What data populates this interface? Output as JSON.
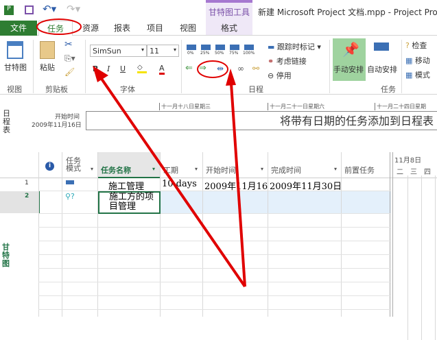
{
  "titlebar": {
    "title": "新建 Microsoft Project 文档.mpp - Project Profess",
    "context_group": "甘特图工具"
  },
  "tabs": [
    "文件",
    "任务",
    "资源",
    "报表",
    "项目",
    "视图",
    "格式"
  ],
  "ribbon": {
    "view": {
      "gantt": "甘特图",
      "group": "视图"
    },
    "clipboard": {
      "paste": "粘贴",
      "group": "剪贴板"
    },
    "font": {
      "name": "SimSun",
      "size": "11",
      "bold": "B",
      "italic": "I",
      "underline": "U",
      "font_color": "A",
      "group": "字体"
    },
    "schedule": {
      "percents": [
        "0%",
        "25%",
        "50%",
        "75%",
        "100%"
      ],
      "track": "跟踪时标记",
      "respect_links": "考虑链接",
      "inactivate": "停用",
      "group": "日程"
    },
    "tasks": {
      "manual": "手动安排",
      "auto": "自动安排",
      "inspect": "检查",
      "move": "移动",
      "mode": "模式",
      "group": "任务"
    }
  },
  "timeline": {
    "side_label": "日程表",
    "start_label": "开始时间",
    "start_date": "2009年11月16日",
    "dates": [
      "十一月十八日星期三",
      "十一月二十一日星期六",
      "十一月二十四日星期"
    ],
    "placeholder": "将带有日期的任务添加到日程表"
  },
  "grid": {
    "side_label": "甘特图",
    "columns": [
      "任务模式",
      "任务名称",
      "工期",
      "开始时间",
      "完成时间",
      "前置任务"
    ],
    "rows": [
      {
        "id": "1",
        "name": "施工管理",
        "duration": "10 days",
        "start": "2009年11月16日",
        "finish": "2009年11月30日"
      },
      {
        "id": "2",
        "name": "施工方的项目管理",
        "duration": "",
        "start": "",
        "finish": ""
      }
    ]
  },
  "chart": {
    "date": "11月8日",
    "days": [
      "二",
      "三",
      "四"
    ]
  },
  "colors": {
    "file_tab": "#2e7d32",
    "accent": "#217346",
    "annotation": "#e00000",
    "context": "#a678d0"
  }
}
